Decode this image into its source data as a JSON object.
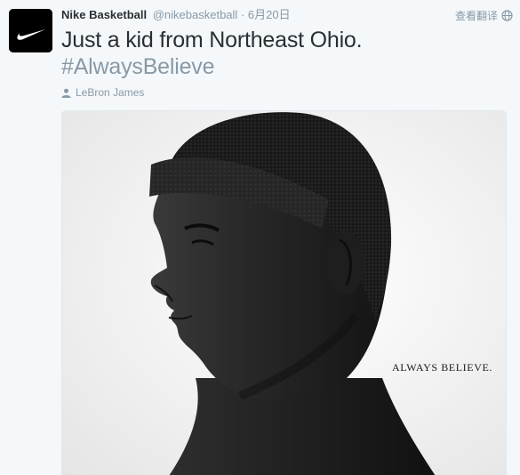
{
  "author": {
    "name": "Nike Basketball",
    "handle": "@nikebasketball",
    "separator": "·",
    "timestamp": "6月20日",
    "avatar_icon": "nike-swoosh-icon"
  },
  "actions": {
    "translate_label": "查看翻译",
    "translate_icon": "globe-icon"
  },
  "tweet": {
    "text_line": "Just a kid from Northeast Ohio.",
    "hashtag": "#AlwaysBelieve"
  },
  "tagged": {
    "icon": "person-icon",
    "name": "LeBron James"
  },
  "media": {
    "overlay_text": "ALWAYS BELIEVE."
  },
  "colors": {
    "background": "#f5f8fa",
    "primary_text": "#292f33",
    "secondary_text": "#8899a6",
    "border": "#e1e8ed"
  }
}
